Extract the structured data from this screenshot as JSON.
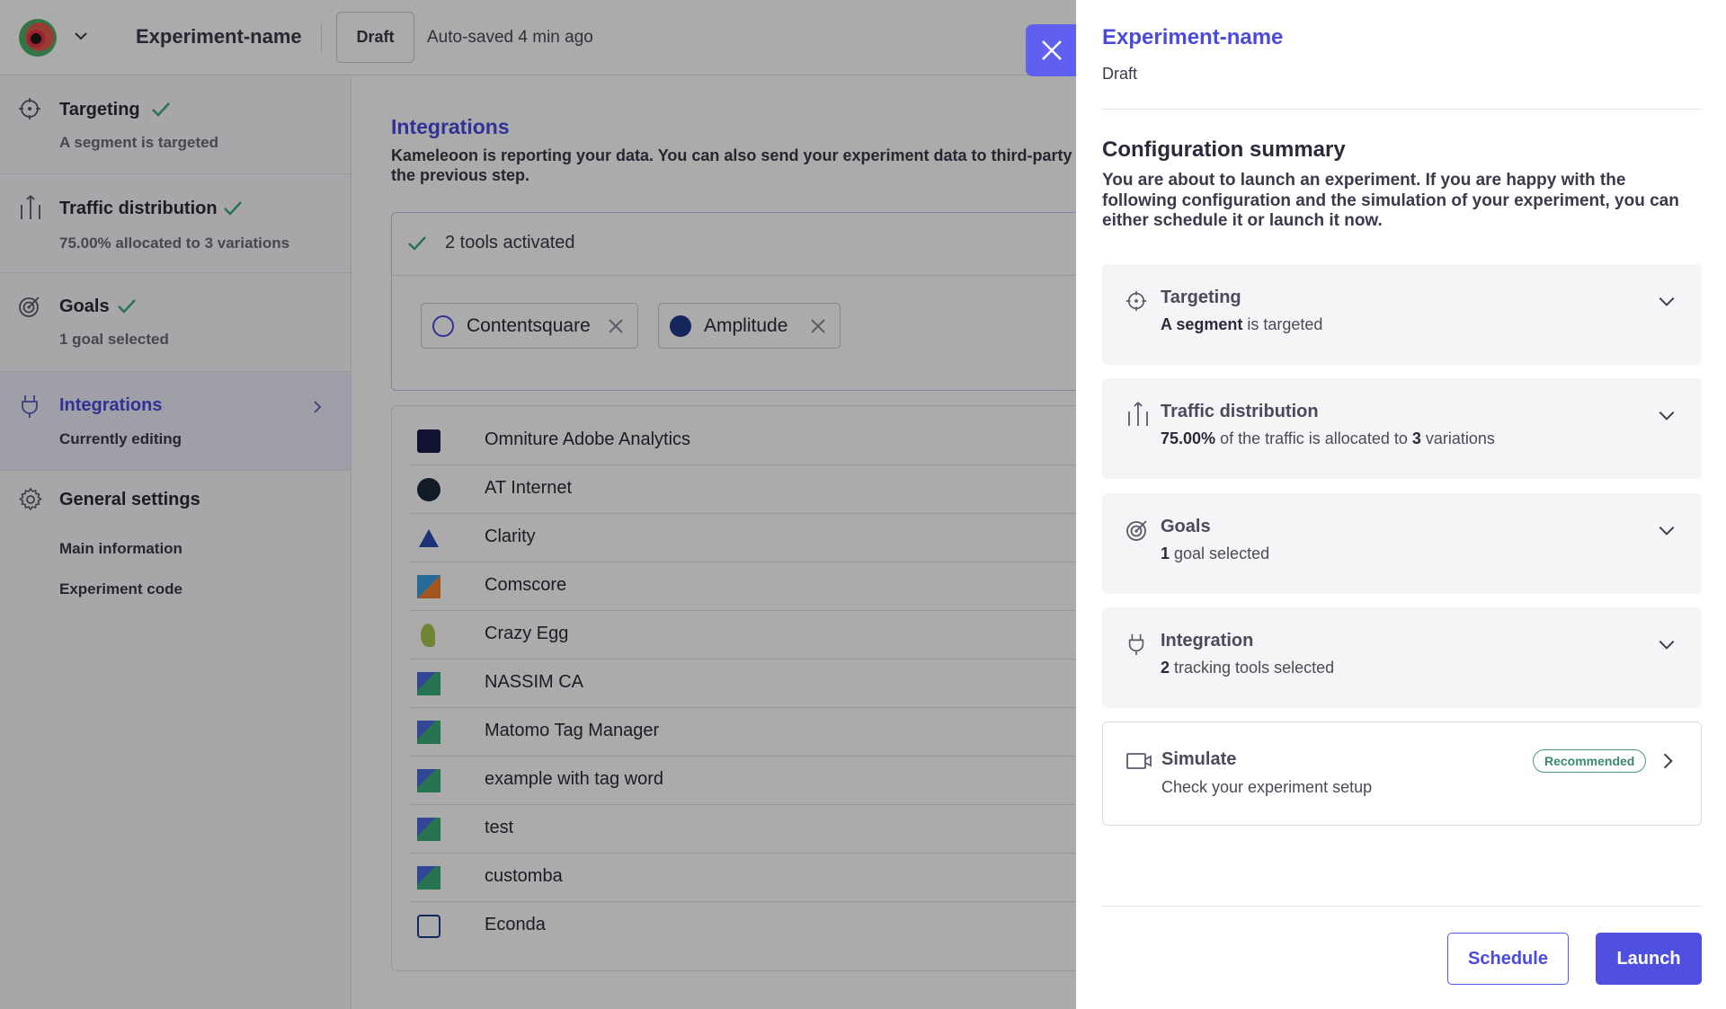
{
  "header": {
    "experiment_name": "Experiment-name",
    "status": "Draft",
    "autosave": "Auto-saved 4 min ago"
  },
  "sidebar": {
    "items": [
      {
        "title": "Targeting",
        "subtitle": "A segment is targeted",
        "done": true,
        "icon": "crosshair-icon"
      },
      {
        "title": "Traffic distribution",
        "subtitle": "75.00% allocated to 3 variations",
        "done": true,
        "icon": "traffic-split-icon"
      },
      {
        "title": "Goals",
        "subtitle": "1 goal selected",
        "done": true,
        "icon": "target-icon"
      },
      {
        "title": "Integrations",
        "subtitle": "Currently editing",
        "done": false,
        "active": true,
        "icon": "plug-icon"
      },
      {
        "title": "General settings",
        "subtitle": "",
        "icon": "gear-icon"
      }
    ],
    "settings_links": [
      "Main information",
      "Experiment code"
    ]
  },
  "main": {
    "title": "Integrations",
    "description": "Kameleoon is reporting your data. You can also send your experiment data to third-party to the previous step.",
    "tools_count": "2 tools activated",
    "active_tools": [
      "Contentsquare",
      "Amplitude"
    ],
    "integrations": [
      "Omniture Adobe Analytics",
      "AT Internet",
      "Clarity",
      "Comscore",
      "Crazy Egg",
      "NASSIM CA",
      "Matomo Tag Manager",
      "example with tag word",
      "test",
      "customba",
      "Econda"
    ]
  },
  "drawer": {
    "title": "Experiment-name",
    "status": "Draft",
    "section_title": "Configuration summary",
    "intro": "You are about to launch an experiment. If you are happy with the following configuration and the simulation of your experiment, you can either schedule it or launch it now.",
    "cards": {
      "targeting": {
        "title": "Targeting",
        "desc_bold": "A segment",
        "desc_rest": " is targeted"
      },
      "traffic": {
        "title": "Traffic distribution",
        "pct": "75.00%",
        "mid": " of the traffic is allocated to ",
        "count": "3",
        "end": " variations"
      },
      "goals": {
        "title": "Goals",
        "count": "1",
        "rest": " goal selected"
      },
      "integration": {
        "title": "Integration",
        "count": "2",
        "rest": " tracking tools selected"
      }
    },
    "simulate": {
      "title": "Simulate",
      "desc": "Check your experiment setup",
      "badge": "Recommended"
    },
    "schedule_label": "Schedule",
    "launch_label": "Launch"
  },
  "colors": {
    "accent": "#4a4ae0",
    "success": "#3aaa7a",
    "overlay": "rgba(0,0,0,0.33)"
  }
}
